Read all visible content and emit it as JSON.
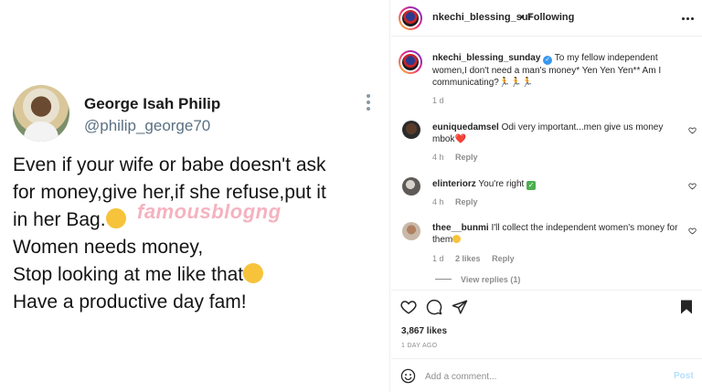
{
  "tweet": {
    "name": "George Isah Philip",
    "handle": "@philip_george70",
    "lines": [
      "Even if your wife or babe doesn't ask",
      "for money,give her,if she refuse,put it",
      "in her Bag.",
      "Women needs money,",
      "Stop looking at me like that",
      "Have a productive day fam!"
    ],
    "watermark": "famousblogng"
  },
  "header": {
    "username": "nkechi_blessing_sur",
    "separator": "•",
    "follow_status": "Following"
  },
  "caption": {
    "username": "nkechi_blessing_sunday",
    "verified_mark": "✓",
    "text": "To my fellow independent women,I don't need a man's money* Yen Yen Yen** Am I communicating?🏃🏃🏃",
    "time": "1 d"
  },
  "comments": [
    {
      "username": "euniquedamsel",
      "text": "Odi very important...men give us money mbok",
      "emoji": "❤️",
      "time": "4 h",
      "reply": "Reply",
      "likes": ""
    },
    {
      "username": "elinteriorz",
      "text": "You're right",
      "emoji": "✅",
      "time": "4 h",
      "reply": "Reply",
      "likes": ""
    },
    {
      "username": "thee__bunmi",
      "text": "I'll collect the independent women's money for them",
      "emoji": "😂",
      "time": "1 d",
      "reply": "Reply",
      "likes": "2 likes"
    }
  ],
  "view_replies": "View replies (1)",
  "likes_count": "3,867 likes",
  "time_ago": "1 DAY AGO",
  "add_comment": {
    "placeholder": "Add a comment...",
    "post_label": "Post"
  },
  "colors": {
    "link_blue": "#3897f0",
    "post_disabled": "#b2dffc",
    "muted": "#8e8e8e",
    "watermark": "#f4a5b4"
  },
  "icons": [
    "more-icon",
    "verified-icon",
    "heart-icon",
    "comment-icon",
    "share-icon",
    "bookmark-icon",
    "emoji-icon"
  ]
}
